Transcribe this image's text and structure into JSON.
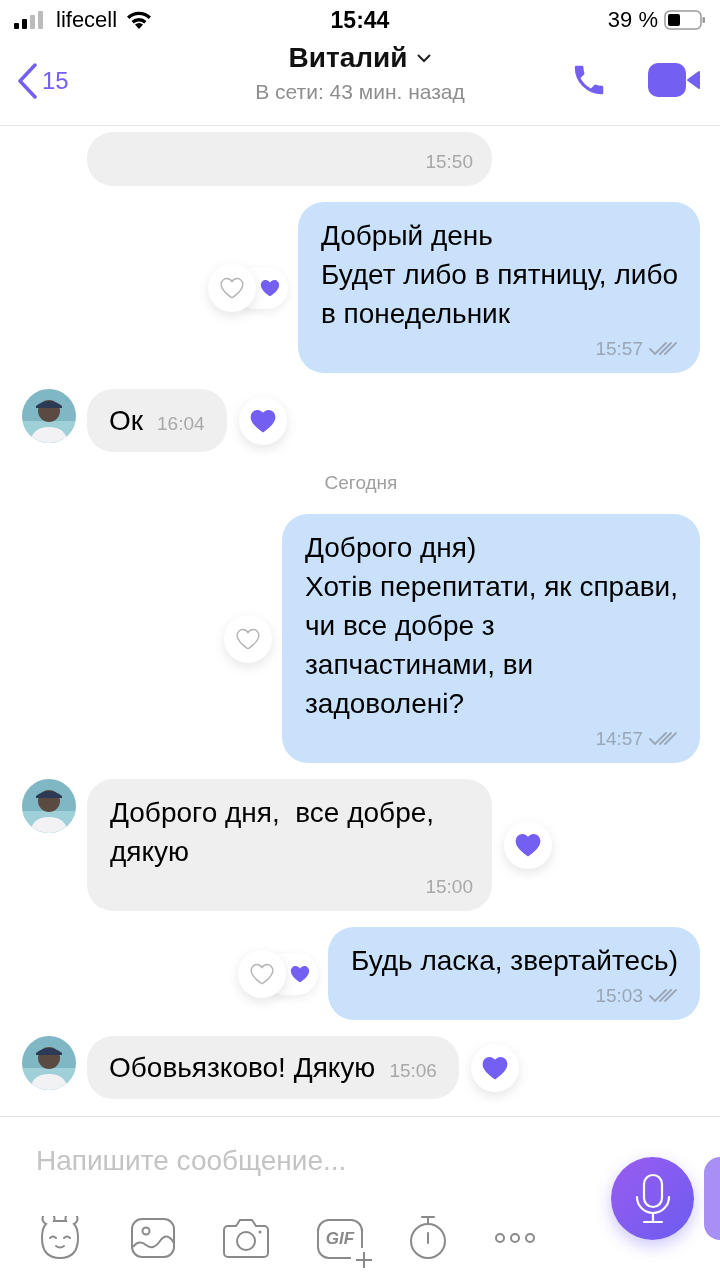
{
  "status_bar": {
    "carrier": "lifecell",
    "time": "15:44",
    "battery": "39 %"
  },
  "header": {
    "back_count": "15",
    "name": "Виталий",
    "status": "В сети: 43 мин. назад"
  },
  "messages": [
    {
      "kind": "in",
      "avatar": false,
      "compact": false,
      "time": "15:50"
    },
    {
      "kind": "out",
      "text": "Добрый день\nБудет либо в пятницу, либо\nв понедельник",
      "time": "15:57",
      "read": true,
      "liked": false,
      "contact_liked": true
    },
    {
      "kind": "in",
      "avatar": true,
      "compact": true,
      "text": "Ок",
      "time": "16:04",
      "liked": true
    },
    {
      "kind": "date",
      "text": "Сегодня"
    },
    {
      "kind": "out",
      "text": "Доброго дня)\nХотів перепитати, як справи,\nчи все добре з\nзапчастинами, ви\nзадоволені?",
      "time": "14:57",
      "read": true,
      "liked": false,
      "contact_liked": false
    },
    {
      "kind": "in",
      "avatar": true,
      "compact": false,
      "text": "Доброго дня,  все добре,\nдякую",
      "time": "15:00",
      "liked": true
    },
    {
      "kind": "out",
      "text": "Будь ласка, звертайтесь)",
      "time": "15:03",
      "read": true,
      "liked": false,
      "contact_liked": true
    },
    {
      "kind": "in",
      "avatar": true,
      "compact": true,
      "text": "Обовьязково! Дякую",
      "time": "15:06",
      "liked": true
    }
  ],
  "composer": {
    "placeholder": "Напишите сообщение..."
  },
  "toolbar": [
    {
      "kind": "sticker"
    },
    {
      "kind": "gallery"
    },
    {
      "kind": "camera"
    },
    {
      "kind": "gif",
      "label": "GIF"
    },
    {
      "kind": "timer"
    },
    {
      "kind": "more"
    }
  ]
}
